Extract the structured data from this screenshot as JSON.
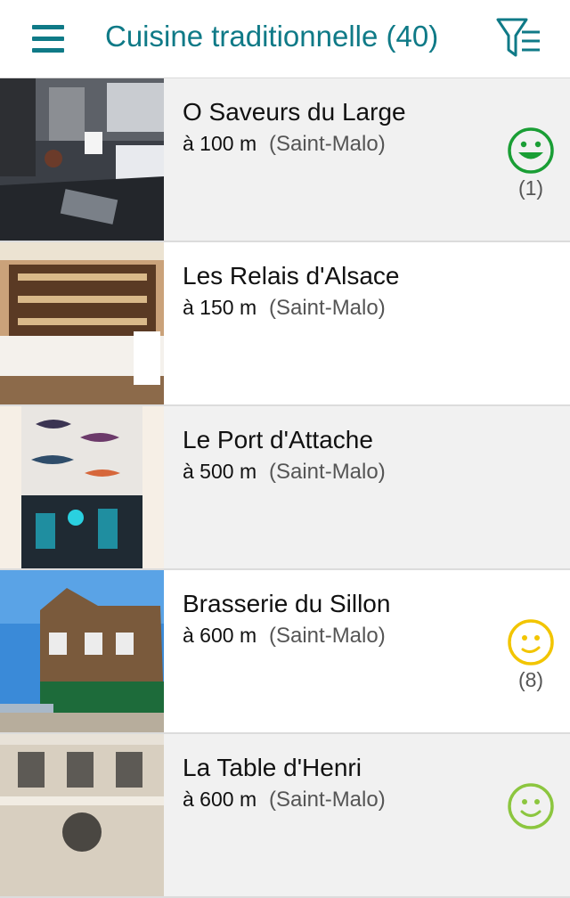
{
  "header": {
    "title": "Cuisine traditionnelle (40)",
    "menu_icon": "hamburger-menu-icon",
    "filter_icon": "filter-icon"
  },
  "colors": {
    "accent": "#0f7a87",
    "rating_green": "#1a9e35",
    "rating_yellow": "#f2c500",
    "rating_lightgreen": "#8cc63f"
  },
  "restaurants": [
    {
      "name": "O Saveurs du Large",
      "distance": "à 100 m",
      "city": "(Saint-Malo)",
      "rating_icon": "big-smile-icon",
      "rating_count": "(1)"
    },
    {
      "name": "Les Relais d'Alsace",
      "distance": "à 150 m",
      "city": "(Saint-Malo)"
    },
    {
      "name": "Le Port d'Attache",
      "distance": "à 500 m",
      "city": "(Saint-Malo)"
    },
    {
      "name": "Brasserie du Sillon",
      "distance": "à 600 m",
      "city": "(Saint-Malo)",
      "rating_icon": "smile-icon",
      "rating_count": "(8)"
    },
    {
      "name": "La Table d'Henri",
      "distance": "à 600 m",
      "city": "(Saint-Malo)",
      "rating_icon": "smile-icon"
    }
  ]
}
